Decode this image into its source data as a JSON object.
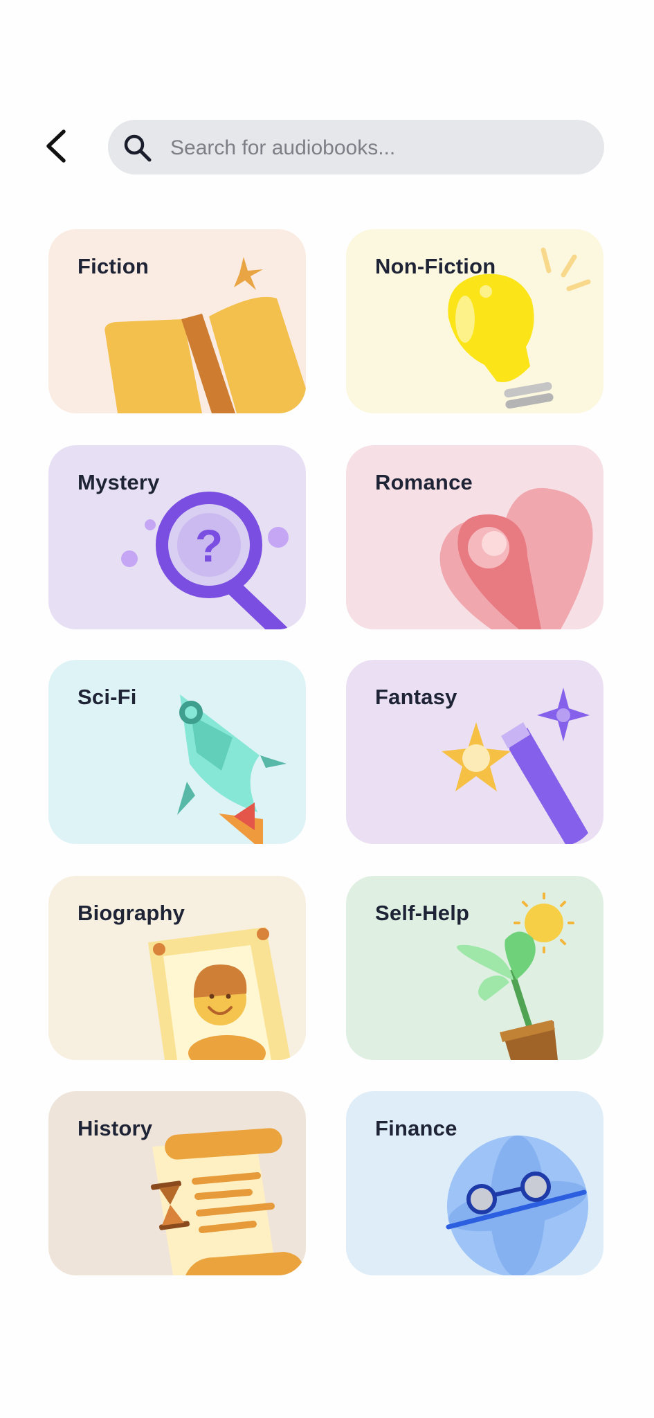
{
  "search": {
    "placeholder": "Search for audiobooks..."
  },
  "categories": [
    {
      "label": "Fiction",
      "bg": "#fbece3"
    },
    {
      "label": "Non-Fiction",
      "bg": "#fcf7df"
    },
    {
      "label": "Mystery",
      "bg": "#e7e0f4"
    },
    {
      "label": "Romance",
      "bg": "#f6e0e6"
    },
    {
      "label": "Sci-Fi",
      "bg": "#def3f5"
    },
    {
      "label": "Fantasy",
      "bg": "#ebe0f3"
    },
    {
      "label": "Biography",
      "bg": "#f7efe0"
    },
    {
      "label": "Self-Help",
      "bg": "#dff0e3"
    },
    {
      "label": "History",
      "bg": "#efe4da"
    },
    {
      "label": "Finance",
      "bg": "#dfedf8"
    }
  ],
  "icons": {
    "back": "chevron-left-icon",
    "search": "search-icon"
  }
}
